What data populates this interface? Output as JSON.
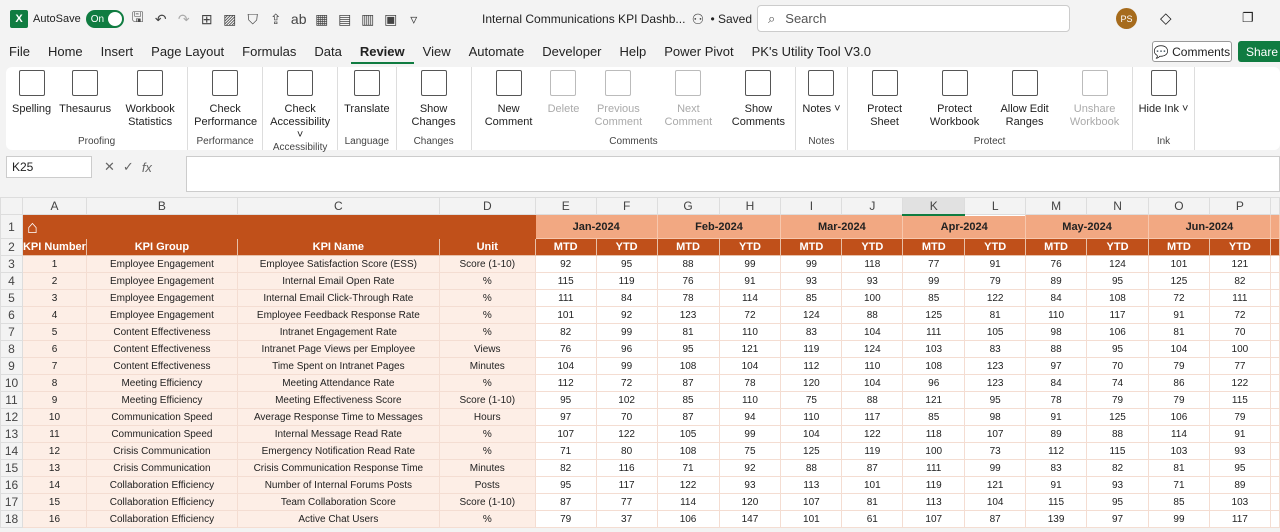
{
  "titlebar": {
    "app_icon": "excel-icon",
    "autosave_label": "AutoSave",
    "autosave_state": "On",
    "doc_title": "Internal Communications KPI Dashb...",
    "saved": "• Saved",
    "search_placeholder": "Search",
    "avatar": "PS"
  },
  "tabs": [
    "File",
    "Home",
    "Insert",
    "Page Layout",
    "Formulas",
    "Data",
    "Review",
    "View",
    "Automate",
    "Developer",
    "Help",
    "Power Pivot",
    "PK's Utility Tool V3.0"
  ],
  "active_tab": "Review",
  "buttons": {
    "comments": "Comments",
    "share": "Share"
  },
  "ribbon": [
    {
      "label": "Proofing",
      "items": [
        {
          "label": "Spelling",
          "icon": "spelling-icon"
        },
        {
          "label": "Thesaurus",
          "icon": "thesaurus-icon"
        },
        {
          "label": "Workbook Statistics",
          "icon": "workbook-statistics-icon"
        }
      ]
    },
    {
      "label": "Performance",
      "items": [
        {
          "label": "Check Performance",
          "icon": "check-performance-icon"
        }
      ]
    },
    {
      "label": "Accessibility",
      "items": [
        {
          "label": "Check Accessibility ˅",
          "icon": "check-accessibility-icon"
        }
      ]
    },
    {
      "label": "Language",
      "items": [
        {
          "label": "Translate",
          "icon": "translate-icon"
        }
      ]
    },
    {
      "label": "Changes",
      "items": [
        {
          "label": "Show Changes",
          "icon": "show-changes-icon"
        }
      ]
    },
    {
      "label": "Comments",
      "items": [
        {
          "label": "New Comment",
          "icon": "new-comment-icon"
        },
        {
          "label": "Delete",
          "icon": "delete-comment-icon",
          "disabled": true
        },
        {
          "label": "Previous Comment",
          "icon": "previous-comment-icon",
          "disabled": true
        },
        {
          "label": "Next Comment",
          "icon": "next-comment-icon",
          "disabled": true
        },
        {
          "label": "Show Comments",
          "icon": "show-comments-icon"
        }
      ]
    },
    {
      "label": "Notes",
      "items": [
        {
          "label": "Notes ˅",
          "icon": "notes-icon"
        }
      ]
    },
    {
      "label": "Protect",
      "items": [
        {
          "label": "Protect Sheet",
          "icon": "protect-sheet-icon"
        },
        {
          "label": "Protect Workbook",
          "icon": "protect-workbook-icon"
        },
        {
          "label": "Allow Edit Ranges",
          "icon": "allow-edit-ranges-icon"
        },
        {
          "label": "Unshare Workbook",
          "icon": "unshare-workbook-icon",
          "disabled": true
        }
      ]
    },
    {
      "label": "Ink",
      "items": [
        {
          "label": "Hide Ink ˅",
          "icon": "hide-ink-icon"
        }
      ]
    }
  ],
  "formula_bar": {
    "name_box": "K25",
    "fx": "fx",
    "formula": ""
  },
  "sheet": {
    "columns": [
      "A",
      "B",
      "C",
      "D",
      "E",
      "F",
      "G",
      "H",
      "I",
      "J",
      "K",
      "L",
      "M",
      "N",
      "O",
      "P"
    ],
    "selected_column": "K",
    "months": [
      "Jan-2024",
      "Feb-2024",
      "Mar-2024",
      "Apr-2024",
      "May-2024",
      "Jun-2024"
    ],
    "headers": [
      "KPI Number",
      "KPI Group",
      "KPI Name",
      "Unit"
    ],
    "sub_headers": [
      "MTD",
      "YTD"
    ],
    "colors": {
      "banner": "#c0501a",
      "month": "#f2a882",
      "left_fill": "#fdeee6"
    },
    "rows": [
      [
        "1",
        "Employee Engagement",
        "Employee Satisfaction Score (ESS)",
        "Score (1-10)",
        92,
        95,
        88,
        99,
        99,
        118,
        77,
        91,
        76,
        124,
        101,
        121
      ],
      [
        "2",
        "Employee Engagement",
        "Internal Email Open Rate",
        "%",
        115,
        119,
        76,
        91,
        93,
        93,
        99,
        79,
        89,
        95,
        125,
        82
      ],
      [
        "3",
        "Employee Engagement",
        "Internal Email Click-Through Rate",
        "%",
        111,
        84,
        78,
        114,
        85,
        100,
        85,
        122,
        84,
        108,
        72,
        111
      ],
      [
        "4",
        "Employee Engagement",
        "Employee Feedback Response Rate",
        "%",
        101,
        92,
        123,
        72,
        124,
        88,
        125,
        81,
        110,
        117,
        91,
        72
      ],
      [
        "5",
        "Content Effectiveness",
        "Intranet Engagement Rate",
        "%",
        82,
        99,
        81,
        110,
        83,
        104,
        111,
        105,
        98,
        106,
        81,
        70
      ],
      [
        "6",
        "Content Effectiveness",
        "Intranet Page Views per Employee",
        "Views",
        76,
        96,
        95,
        121,
        119,
        124,
        103,
        83,
        88,
        95,
        104,
        100
      ],
      [
        "7",
        "Content Effectiveness",
        "Time Spent on Intranet Pages",
        "Minutes",
        104,
        99,
        108,
        104,
        112,
        110,
        108,
        123,
        97,
        70,
        79,
        77
      ],
      [
        "8",
        "Meeting Efficiency",
        "Meeting Attendance Rate",
        "%",
        112,
        72,
        87,
        78,
        120,
        104,
        96,
        123,
        84,
        74,
        86,
        122
      ],
      [
        "9",
        "Meeting Efficiency",
        "Meeting Effectiveness Score",
        "Score (1-10)",
        95,
        102,
        85,
        110,
        75,
        88,
        121,
        95,
        78,
        79,
        79,
        115
      ],
      [
        "10",
        "Communication Speed",
        "Average Response Time to Messages",
        "Hours",
        97,
        70,
        87,
        94,
        110,
        117,
        85,
        98,
        91,
        125,
        106,
        79
      ],
      [
        "11",
        "Communication Speed",
        "Internal Message Read Rate",
        "%",
        107,
        122,
        105,
        99,
        104,
        122,
        118,
        107,
        89,
        88,
        114,
        91
      ],
      [
        "12",
        "Crisis Communication",
        "Emergency Notification Read Rate",
        "%",
        71,
        80,
        108,
        75,
        125,
        119,
        100,
        73,
        112,
        115,
        103,
        93
      ],
      [
        "13",
        "Crisis Communication",
        "Crisis Communication Response Time",
        "Minutes",
        82,
        116,
        71,
        92,
        88,
        87,
        111,
        99,
        83,
        82,
        81,
        95
      ],
      [
        "14",
        "Collaboration Efficiency",
        "Number of Internal Forums Posts",
        "Posts",
        95,
        117,
        122,
        93,
        113,
        101,
        119,
        121,
        91,
        93,
        71,
        89
      ],
      [
        "15",
        "Collaboration Efficiency",
        "Team Collaboration Score",
        "Score (1-10)",
        87,
        77,
        114,
        120,
        107,
        81,
        113,
        104,
        115,
        95,
        85,
        103
      ],
      [
        "16",
        "Collaboration Efficiency",
        "Active Chat Users",
        "%",
        79,
        37,
        106,
        147,
        101,
        61,
        107,
        87,
        139,
        97,
        99,
        117
      ]
    ]
  }
}
